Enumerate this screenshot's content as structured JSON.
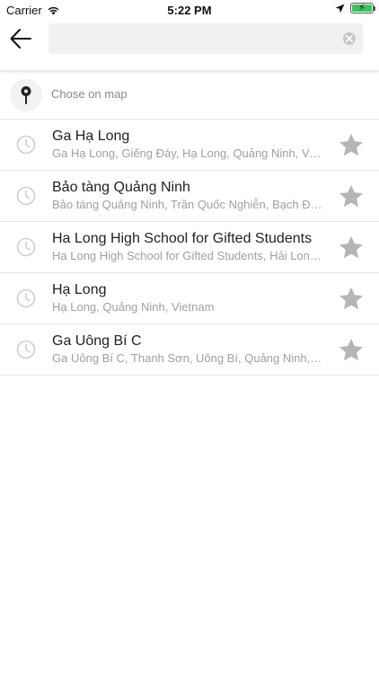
{
  "status_bar": {
    "carrier": "Carrier",
    "time": "5:22 PM"
  },
  "search": {
    "value": "",
    "placeholder": ""
  },
  "map_option": {
    "label": "Chose on map",
    "icon": "map-pin-icon"
  },
  "recent_places": [
    {
      "title": "Ga Hạ Long",
      "subtitle": "Ga Hạ Long, Giếng Đáy, Hạ Long, Quảng Ninh, Vietnam"
    },
    {
      "title": "Bảo tàng Quảng Ninh",
      "subtitle": "Bảo tàng Quảng Ninh, Trần Quốc Nghiễn, Bạch Đằng, Hạ Long, Quảng Ninh, Vietnam"
    },
    {
      "title": "Ha Long High School for Gifted Students",
      "subtitle": "Ha Long High School for Gifted Students, Hải Long, Quảng Ninh, Vietnam"
    },
    {
      "title": "Hạ Long",
      "subtitle": "Hạ Long, Quảng Ninh, Vietnam"
    },
    {
      "title": "Ga Uông Bí C",
      "subtitle": "Ga Uông Bí C, Thanh Sơn, Uông Bí, Quảng Ninh, Vietnam"
    }
  ],
  "colors": {
    "battery": "#34c759",
    "icon_gray": "#cfcfcf",
    "star_gray": "#b5b5b5"
  }
}
